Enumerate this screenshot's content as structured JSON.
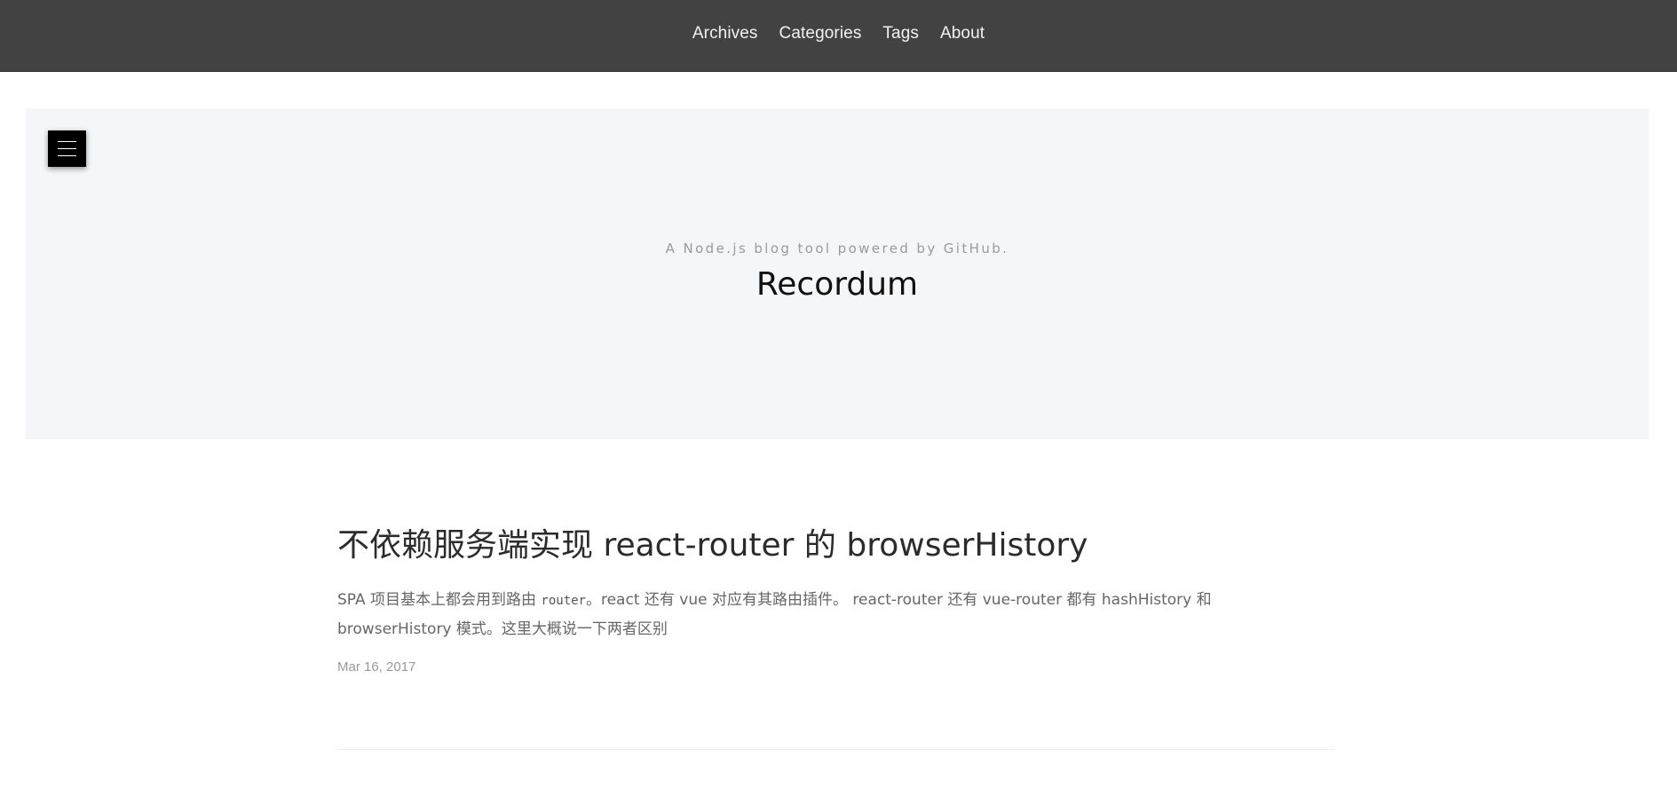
{
  "nav": {
    "items": [
      {
        "label": "Archives"
      },
      {
        "label": "Categories"
      },
      {
        "label": "Tags"
      },
      {
        "label": "About"
      }
    ]
  },
  "hero": {
    "tagline": "A Node.js blog tool powered by GitHub.",
    "title": "Recordum",
    "menu_icon": "hamburger-menu-icon"
  },
  "posts": [
    {
      "title": "不依赖服务端实现 react-router 的 browserHistory",
      "excerpt_before": "SPA 项目基本上都会用到路由 ",
      "excerpt_code": "router",
      "excerpt_after": "。react 还有 vue 对应有其路由插件。 react-router 还有 vue-router 都有 hashHistory 和 browserHistory 模式。这里大概说一下两者区别",
      "date": "Mar 16, 2017"
    }
  ],
  "colors": {
    "nav_bg": "#424242",
    "hero_bg": "#f4f7f9",
    "menu_button_bg": "#000000"
  }
}
